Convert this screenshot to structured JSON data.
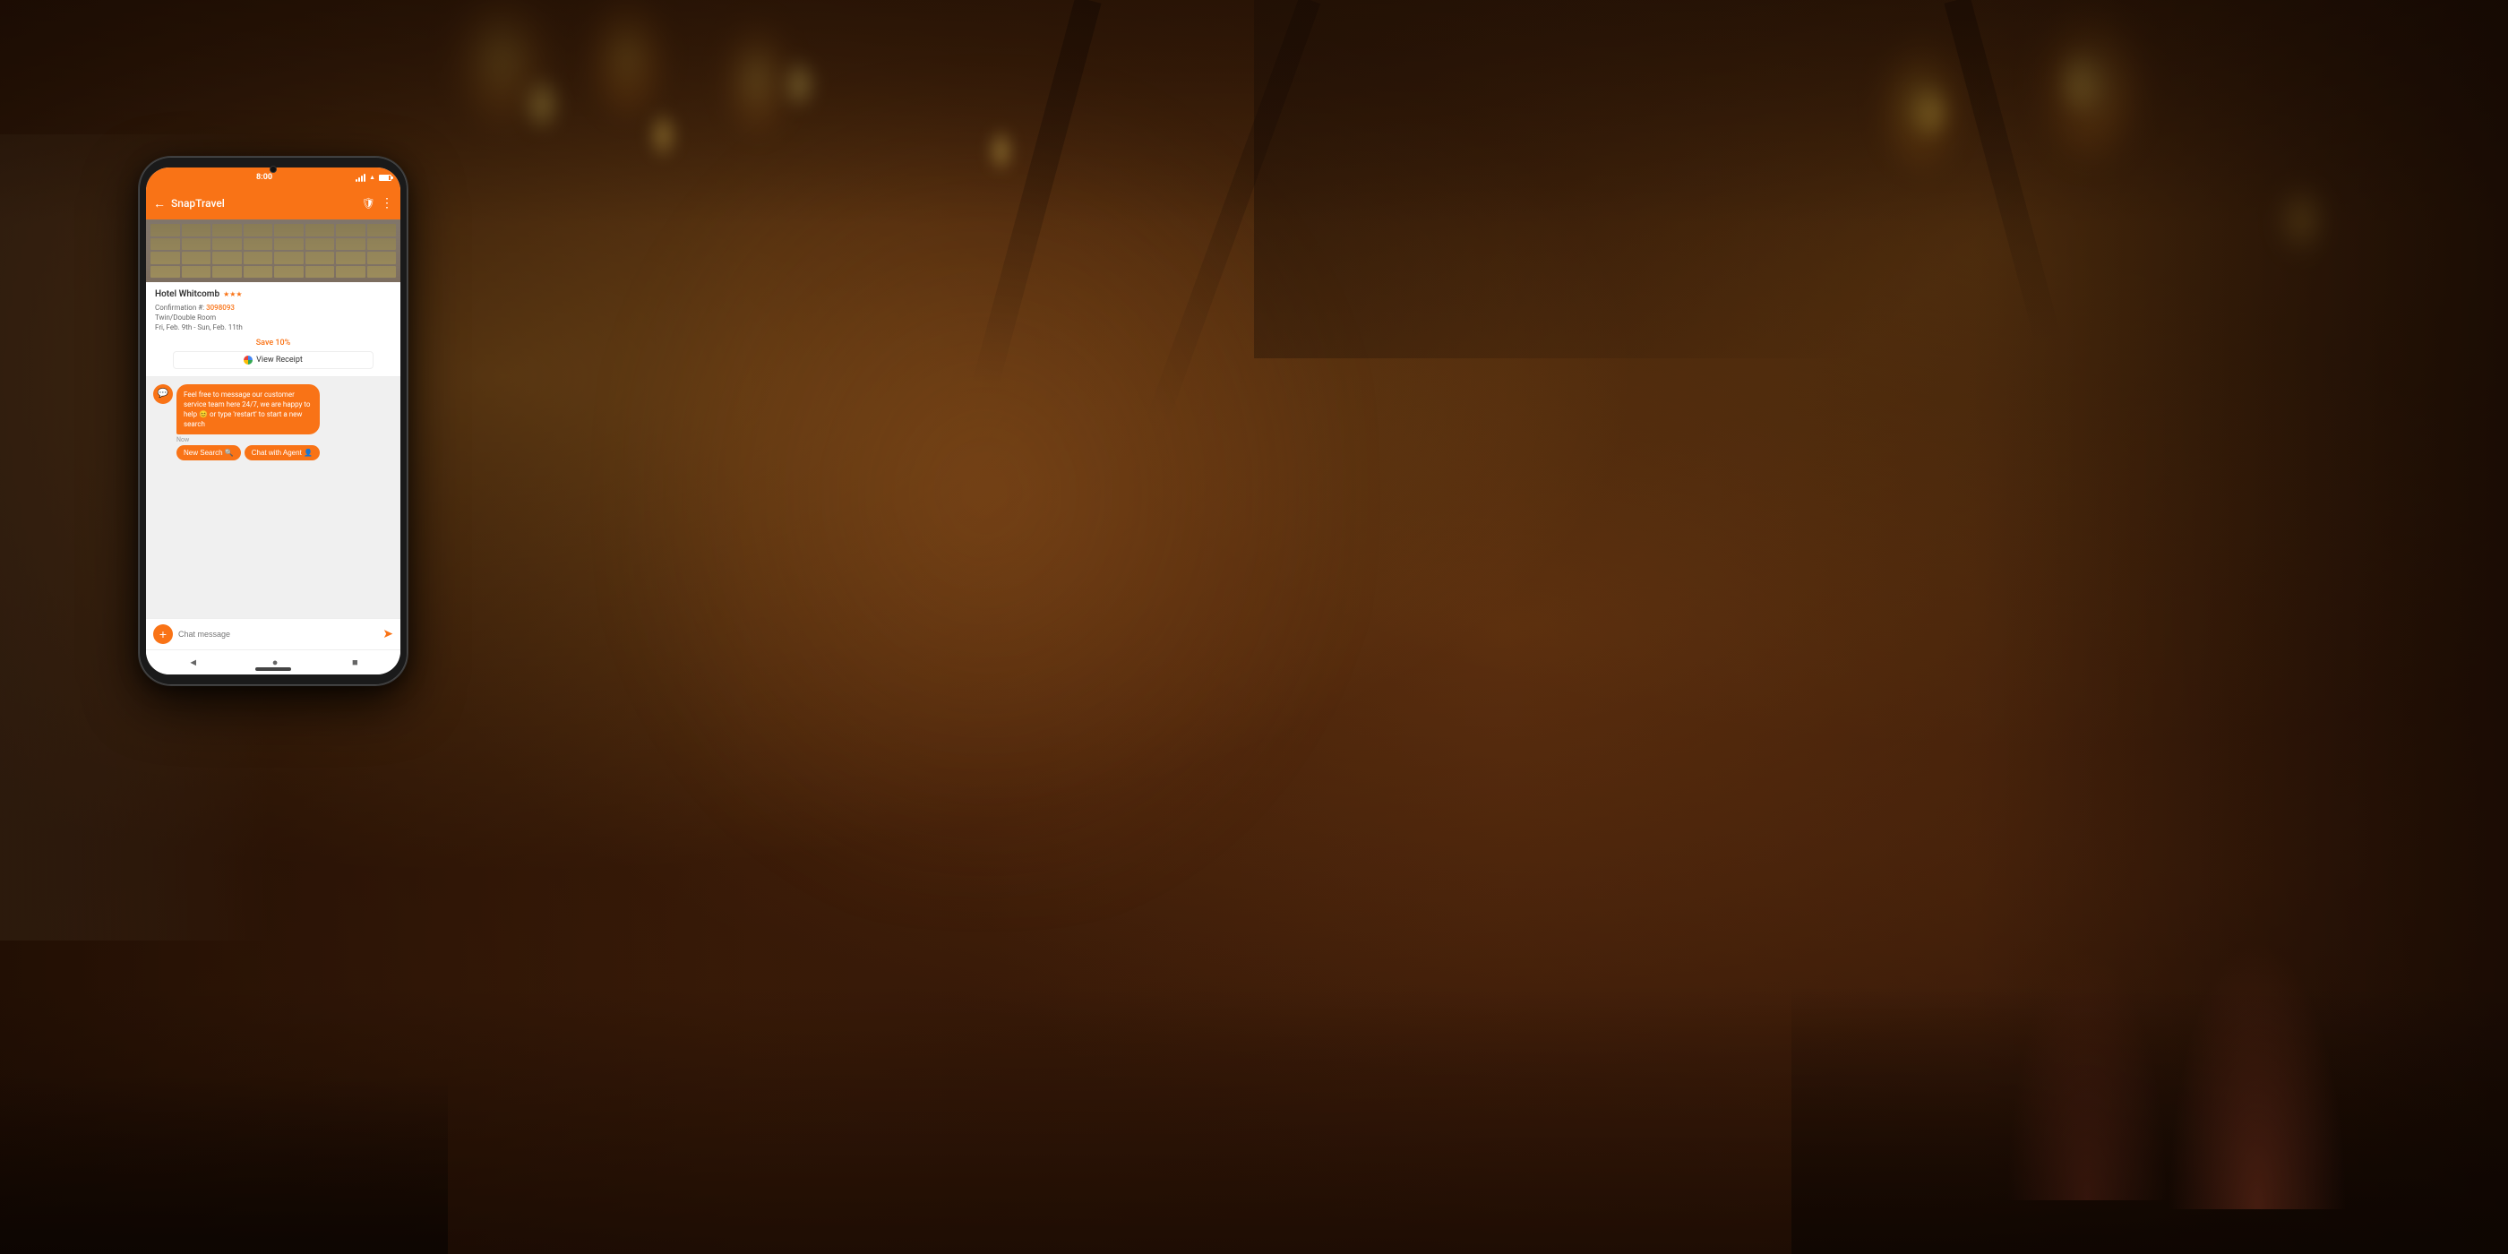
{
  "background": {
    "color": "#3a1a08"
  },
  "phone": {
    "status_bar": {
      "time": "8:00",
      "wifi": "▲",
      "signal_bars": [
        3,
        5,
        7,
        9,
        11
      ],
      "battery_level": 80
    },
    "app_bar": {
      "back_label": "←",
      "title": "SnapTravel",
      "shield_icon": "verified",
      "more_icon": "⋮"
    },
    "hotel_card": {
      "hotel_name": "Hotel Whitcomb",
      "stars_count": 3,
      "stars_display": "★★★",
      "confirmation_label": "Confirmation #: ",
      "confirmation_number": "3098093",
      "room_type": "Twin/Double Room",
      "dates": "Fri, Feb. 9th - Sun, Feb. 11th",
      "save_text": "Save 10%",
      "view_receipt_label": "View Receipt"
    },
    "chat": {
      "message_text": "Feel free to message our customer service team here 24/7, we are happy to help 😊 or type 'restart' to start a new search",
      "timestamp": "Now",
      "new_search_label": "New Search 🔍",
      "chat_agent_label": "Chat with Agent 👤"
    },
    "input": {
      "add_icon": "+",
      "placeholder": "Chat message",
      "send_icon": "➤"
    },
    "bottom_nav": {
      "back_icon": "◄",
      "home_icon": "●",
      "recent_icon": "■"
    }
  }
}
